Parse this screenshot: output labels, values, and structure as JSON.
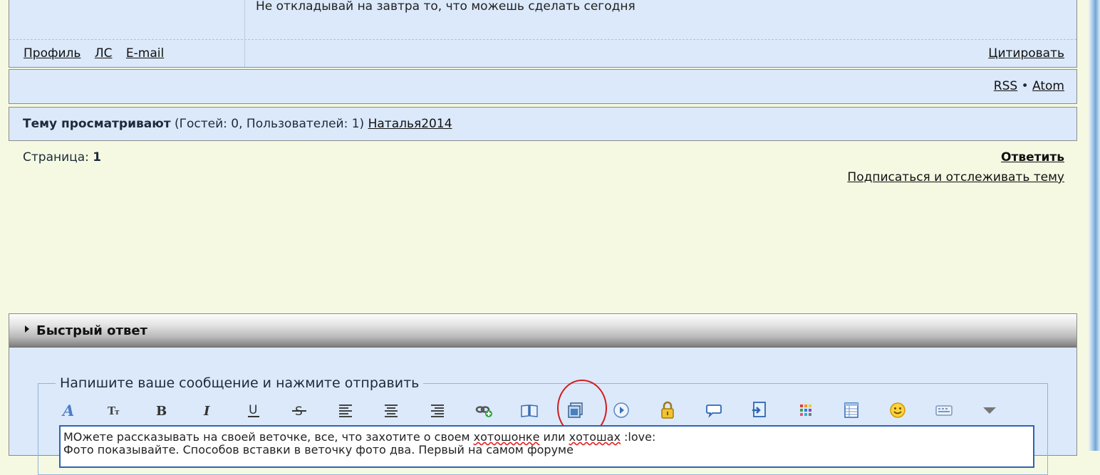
{
  "post": {
    "signature": "Не откладывай на завтра то, что можешь сделать сегодня",
    "links": [
      "Профиль",
      "ЛС",
      "E-mail"
    ],
    "quote_label": "Цитировать"
  },
  "feeds": {
    "rss": "RSS",
    "separator": "•",
    "atom": "Atom"
  },
  "viewers": {
    "label": "Тему просматривают",
    "counts": "(Гостей: 0, Пользователей: 1)",
    "user": "Наталья2014"
  },
  "pagination": {
    "label": "Страница:",
    "current": "1"
  },
  "actions": {
    "reply": "Ответить",
    "subscribe": "Подписаться и отслеживать тему"
  },
  "quick_reply": {
    "title": "Быстрый ответ",
    "legend": "Напишите ваше сообщение и нажмите отправить",
    "toolbar": [
      "font-color-icon",
      "font-size-icon",
      "bold-icon",
      "italic-icon",
      "underline-icon",
      "strikethrough-icon",
      "align-left-icon",
      "align-center-icon",
      "align-right-icon",
      "insert-link-icon",
      "insert-book-icon",
      "insert-image-icon",
      "insert-video-icon",
      "hide-lock-icon",
      "quote-bubble-icon",
      "code-icon",
      "color-grid-icon",
      "table-icon",
      "smiley-icon",
      "keyboard-icon",
      "more-dropdown-icon"
    ],
    "text_line1_a": "МОжете рассказывать на своей веточке, все, что захотите о своем ",
    "word1": "хотошонке",
    "mid": " или ",
    "word2": "хотошах",
    "tail": " :love:",
    "text_line2": "Фото показывайте. Способов вставки в веточку фото два. Первый на самом форуме"
  },
  "colors": {
    "panel": "#dbe9fa",
    "background": "#f5f9e2",
    "highlight_circle": "#d21c1c"
  }
}
